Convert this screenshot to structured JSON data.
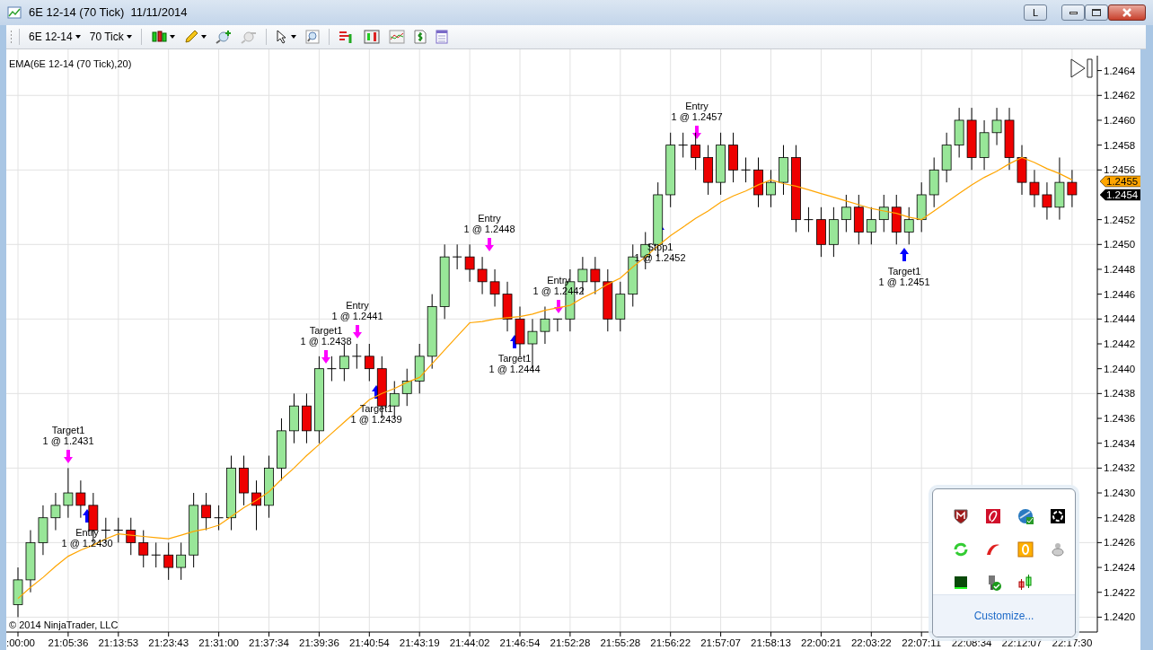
{
  "window": {
    "title": "6E 12-14 (70 Tick)  11/11/2014",
    "layout_button": "L"
  },
  "toolbar": {
    "instrument": "6E 12-14",
    "interval": "70 Tick"
  },
  "chart": {
    "copyright": "© 2014 NinjaTrader, LLC",
    "chart_data": {
      "type": "candlestick",
      "grid": true,
      "categories": [
        ":00:00",
        null,
        null,
        null,
        "21:05:36",
        null,
        null,
        null,
        "21:13:53",
        null,
        null,
        null,
        "21:23:43",
        null,
        null,
        null,
        "21:31:00",
        null,
        null,
        null,
        "21:37:34",
        null,
        null,
        null,
        "21:39:36",
        null,
        null,
        null,
        "21:40:54",
        null,
        null,
        null,
        "21:43:19",
        null,
        null,
        null,
        "21:44:02",
        null,
        null,
        null,
        "21:46:54",
        null,
        null,
        null,
        "21:52:28",
        null,
        null,
        null,
        "21:55:28",
        null,
        null,
        null,
        "21:56:22",
        null,
        null,
        null,
        "21:57:07",
        null,
        null,
        null,
        "21:58:13",
        null,
        null,
        null,
        "22:00:21",
        null,
        null,
        null,
        "22:03:22",
        null,
        null,
        null,
        "22:07:11",
        null,
        null,
        null,
        "22:08:34",
        null,
        null,
        null,
        "22:12:07",
        null,
        null,
        null,
        "22:17:30"
      ],
      "ylim": [
        1.24188,
        1.24652
      ],
      "ohlc": [
        [
          1.2421,
          1.2424,
          1.242,
          1.2423
        ],
        [
          1.2423,
          1.2427,
          1.2422,
          1.2426
        ],
        [
          1.2426,
          1.2429,
          1.2425,
          1.2428
        ],
        [
          1.2428,
          1.243,
          1.2427,
          1.2429
        ],
        [
          1.2429,
          1.2432,
          1.2428,
          1.243
        ],
        [
          1.243,
          1.2431,
          1.2428,
          1.2429
        ],
        [
          1.2429,
          1.243,
          1.2426,
          1.2427
        ],
        [
          1.2427,
          1.2428,
          1.2426,
          1.2427
        ],
        [
          1.2427,
          1.2428,
          1.2426,
          1.2427
        ],
        [
          1.2427,
          1.2428,
          1.2425,
          1.2426
        ],
        [
          1.2426,
          1.2427,
          1.2424,
          1.2425
        ],
        [
          1.2425,
          1.2426,
          1.2424,
          1.2425
        ],
        [
          1.2425,
          1.2426,
          1.2423,
          1.2424
        ],
        [
          1.2424,
          1.2426,
          1.2423,
          1.2425
        ],
        [
          1.2425,
          1.243,
          1.2424,
          1.2429
        ],
        [
          1.2429,
          1.243,
          1.2427,
          1.2428
        ],
        [
          1.2428,
          1.2429,
          1.2427,
          1.2428
        ],
        [
          1.2428,
          1.2433,
          1.2427,
          1.2432
        ],
        [
          1.2432,
          1.2433,
          1.2429,
          1.243
        ],
        [
          1.243,
          1.2431,
          1.2427,
          1.2429
        ],
        [
          1.2429,
          1.2433,
          1.2428,
          1.2432
        ],
        [
          1.2432,
          1.2436,
          1.2431,
          1.2435
        ],
        [
          1.2435,
          1.2438,
          1.2434,
          1.2437
        ],
        [
          1.2437,
          1.2438,
          1.2434,
          1.2435
        ],
        [
          1.2435,
          1.2441,
          1.2434,
          1.244
        ],
        [
          1.244,
          1.2441,
          1.2439,
          1.244
        ],
        [
          1.244,
          1.2442,
          1.2439,
          1.2441
        ],
        [
          1.2441,
          1.2442,
          1.244,
          1.2441
        ],
        [
          1.2441,
          1.2442,
          1.2439,
          1.244
        ],
        [
          1.244,
          1.2441,
          1.2436,
          1.2437
        ],
        [
          1.2437,
          1.2439,
          1.2436,
          1.2438
        ],
        [
          1.2438,
          1.244,
          1.2437,
          1.2439
        ],
        [
          1.2439,
          1.2442,
          1.2438,
          1.2441
        ],
        [
          1.2441,
          1.2446,
          1.244,
          1.2445
        ],
        [
          1.2445,
          1.245,
          1.2444,
          1.2449
        ],
        [
          1.2449,
          1.245,
          1.2448,
          1.2449
        ],
        [
          1.2449,
          1.245,
          1.2447,
          1.2448
        ],
        [
          1.2448,
          1.2449,
          1.2446,
          1.2447
        ],
        [
          1.2447,
          1.2448,
          1.2445,
          1.2446
        ],
        [
          1.2446,
          1.2447,
          1.2443,
          1.2444
        ],
        [
          1.2444,
          1.2445,
          1.2441,
          1.2442
        ],
        [
          1.2442,
          1.2444,
          1.244,
          1.2443
        ],
        [
          1.2443,
          1.2445,
          1.2442,
          1.2444
        ],
        [
          1.2444,
          1.2444,
          1.2443,
          1.2444
        ],
        [
          1.2444,
          1.2448,
          1.2443,
          1.2447
        ],
        [
          1.2447,
          1.2449,
          1.2446,
          1.2448
        ],
        [
          1.2448,
          1.2449,
          1.2446,
          1.2447
        ],
        [
          1.2447,
          1.2448,
          1.2443,
          1.2444
        ],
        [
          1.2444,
          1.2447,
          1.2443,
          1.2446
        ],
        [
          1.2446,
          1.245,
          1.2445,
          1.2449
        ],
        [
          1.2449,
          1.2451,
          1.2448,
          1.245
        ],
        [
          1.245,
          1.2455,
          1.2449,
          1.2454
        ],
        [
          1.2454,
          1.2459,
          1.2453,
          1.2458
        ],
        [
          1.2458,
          1.2459,
          1.2457,
          1.2458
        ],
        [
          1.2458,
          1.2459,
          1.2456,
          1.2457
        ],
        [
          1.2457,
          1.2458,
          1.2454,
          1.2455
        ],
        [
          1.2455,
          1.2459,
          1.2454,
          1.2458
        ],
        [
          1.2458,
          1.2459,
          1.2455,
          1.2456
        ],
        [
          1.2456,
          1.2457,
          1.2455,
          1.2456
        ],
        [
          1.2456,
          1.2457,
          1.2453,
          1.2454
        ],
        [
          1.2454,
          1.2456,
          1.2453,
          1.2455
        ],
        [
          1.2455,
          1.2458,
          1.2454,
          1.2457
        ],
        [
          1.2457,
          1.2458,
          1.2451,
          1.2452
        ],
        [
          1.2452,
          1.2453,
          1.2451,
          1.2452
        ],
        [
          1.2452,
          1.2453,
          1.2449,
          1.245
        ],
        [
          1.245,
          1.2453,
          1.2449,
          1.2452
        ],
        [
          1.2452,
          1.2454,
          1.2451,
          1.2453
        ],
        [
          1.2453,
          1.2454,
          1.245,
          1.2451
        ],
        [
          1.2451,
          1.2453,
          1.245,
          1.2452
        ],
        [
          1.2452,
          1.2454,
          1.2451,
          1.2453
        ],
        [
          1.2453,
          1.2454,
          1.245,
          1.2451
        ],
        [
          1.2451,
          1.2453,
          1.245,
          1.2452
        ],
        [
          1.2452,
          1.2455,
          1.2451,
          1.2454
        ],
        [
          1.2454,
          1.2457,
          1.2453,
          1.2456
        ],
        [
          1.2456,
          1.2459,
          1.2455,
          1.2458
        ],
        [
          1.2458,
          1.2461,
          1.2457,
          1.246
        ],
        [
          1.246,
          1.2461,
          1.2456,
          1.2457
        ],
        [
          1.2457,
          1.246,
          1.2456,
          1.2459
        ],
        [
          1.2459,
          1.2461,
          1.2458,
          1.246
        ],
        [
          1.246,
          1.2461,
          1.2456,
          1.2457
        ],
        [
          1.2457,
          1.2458,
          1.2454,
          1.2455
        ],
        [
          1.2455,
          1.2456,
          1.2453,
          1.2454
        ],
        [
          1.2454,
          1.2455,
          1.2452,
          1.2453
        ],
        [
          1.2453,
          1.2457,
          1.2452,
          1.2455
        ],
        [
          1.2455,
          1.2456,
          1.2453,
          1.2454
        ]
      ],
      "series": [
        {
          "name": "EMA(6E 12-14 (70 Tick),20)",
          "type": "line",
          "color": "#ffa500",
          "values": [
            1.24215,
            1.24224,
            1.24232,
            1.24241,
            1.24249,
            1.24254,
            1.24258,
            1.24263,
            1.24267,
            1.24266,
            1.24265,
            1.24264,
            1.24263,
            1.24266,
            1.24269,
            1.24271,
            1.24274,
            1.24281,
            1.24288,
            1.24294,
            1.24301,
            1.24311,
            1.2432,
            1.2433,
            1.24339,
            1.24348,
            1.24357,
            1.24366,
            1.24375,
            1.2438,
            1.24384,
            1.24389,
            1.24393,
            1.24404,
            1.24415,
            1.24426,
            1.24437,
            1.24438,
            1.2444,
            1.24441,
            1.24442,
            1.24444,
            1.24447,
            1.24449,
            1.24451,
            1.24457,
            1.24462,
            1.24468,
            1.24473,
            1.24482,
            1.2449,
            1.24499,
            1.24507,
            1.24514,
            1.24521,
            1.24527,
            1.24534,
            1.24539,
            1.24543,
            1.24548,
            1.24552,
            1.24549,
            1.24547,
            1.24544,
            1.24541,
            1.24538,
            1.24535,
            1.24532,
            1.24529,
            1.24527,
            1.24525,
            1.24522,
            1.2452,
            1.24527,
            1.24534,
            1.24541,
            1.24548,
            1.24554,
            1.24559,
            1.24565,
            1.2457,
            1.24566,
            1.24561,
            1.24557,
            1.24552
          ]
        }
      ],
      "yticks": [
        {
          "value": 1.2464,
          "label": "1.2464"
        },
        {
          "value": 1.2462,
          "label": "1.2462"
        },
        {
          "value": 1.246,
          "label": "1.2460"
        },
        {
          "value": 1.2458,
          "label": "1.2458"
        },
        {
          "value": 1.2456,
          "label": "1.2456"
        },
        {
          "value": 1.2452,
          "label": "1.2452"
        },
        {
          "value": 1.245,
          "label": "1.2450"
        },
        {
          "value": 1.2448,
          "label": "1.2448"
        },
        {
          "value": 1.2446,
          "label": "1.2446"
        },
        {
          "value": 1.2444,
          "label": "1.2444"
        },
        {
          "value": 1.2442,
          "label": "1.2442"
        },
        {
          "value": 1.244,
          "label": "1.2440"
        },
        {
          "value": 1.2438,
          "label": "1.2438"
        },
        {
          "value": 1.2436,
          "label": "1.2436"
        },
        {
          "value": 1.2434,
          "label": "1.2434"
        },
        {
          "value": 1.2432,
          "label": "1.2432"
        },
        {
          "value": 1.243,
          "label": "1.2430"
        },
        {
          "value": 1.2428,
          "label": "1.2428"
        },
        {
          "value": 1.2426,
          "label": "1.2426"
        },
        {
          "value": 1.2424,
          "label": "1.2424"
        },
        {
          "value": 1.2422,
          "label": "1.2422"
        },
        {
          "value": 1.242,
          "label": "1.2420"
        }
      ]
    },
    "price_markers": [
      {
        "text": "1.2455",
        "color": "#ffa500"
      },
      {
        "text": "1.2454",
        "color": "#000000"
      }
    ],
    "trades": [
      {
        "kind": "sell",
        "signal": "Target1",
        "fill": "1 @ 1.2431"
      },
      {
        "kind": "buy",
        "signal": "Entry",
        "fill": "1 @ 1.2430"
      },
      {
        "kind": "sell",
        "signal": "Target1",
        "fill": "1 @ 1.2438"
      },
      {
        "kind": "sell",
        "signal": "Entry",
        "fill": "1 @ 1.2441"
      },
      {
        "kind": "buy",
        "signal": "Target1",
        "fill": "1 @ 1.2439"
      },
      {
        "kind": "sell",
        "signal": "Entry",
        "fill": "1 @ 1.2448"
      },
      {
        "kind": "buy",
        "signal": "Target1",
        "fill": "1 @ 1.2444"
      },
      {
        "kind": "sell",
        "signal": "Entry",
        "fill": "1 @ 1.2442"
      },
      {
        "kind": "buy",
        "signal": "Stop1",
        "fill": "1 @ 1.2452"
      },
      {
        "kind": "sell",
        "signal": "Entry",
        "fill": "1 @ 1.2457"
      },
      {
        "kind": "buy",
        "signal": "Target1",
        "fill": "1 @ 1.2451"
      }
    ]
  },
  "tray": {
    "link": "Customize..."
  }
}
